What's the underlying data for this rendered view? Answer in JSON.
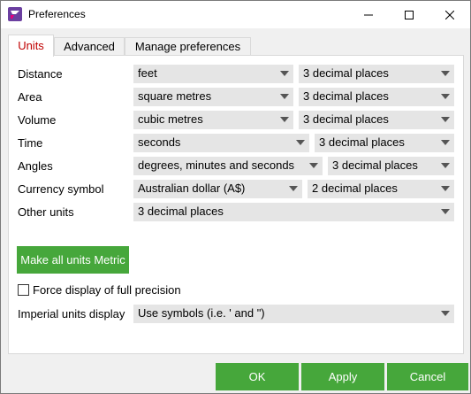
{
  "window": {
    "title": "Preferences"
  },
  "tabs": [
    {
      "label": "Units",
      "active": true
    },
    {
      "label": "Advanced",
      "active": false
    },
    {
      "label": "Manage preferences",
      "active": false
    }
  ],
  "units": {
    "rows": [
      {
        "label": "Distance",
        "unit": "feet",
        "precision": "3 decimal places"
      },
      {
        "label": "Area",
        "unit": "square metres",
        "precision": "3 decimal places"
      },
      {
        "label": "Volume",
        "unit": "cubic metres",
        "precision": "3 decimal places"
      },
      {
        "label": "Time",
        "unit": "seconds",
        "precision": "3 decimal places"
      },
      {
        "label": "Angles",
        "unit": "degrees, minutes and seconds",
        "precision": "3 decimal places"
      },
      {
        "label": "Currency symbol",
        "unit": "Australian dollar (A$)",
        "precision": "2 decimal places"
      }
    ],
    "other_units": {
      "label": "Other units",
      "value": "3 decimal places"
    },
    "metric_button": "Make all units Metric",
    "force_precision": {
      "label": "Force display of full precision",
      "checked": false
    },
    "imperial": {
      "label": "Imperial units display",
      "value": "Use symbols (i.e. ' and \")"
    }
  },
  "footer": {
    "ok": "OK",
    "apply": "Apply",
    "cancel": "Cancel"
  },
  "colors": {
    "accent_green": "#46a73b",
    "active_tab_text": "#c00000",
    "combo_bg": "#e5e5e5"
  },
  "icons": {
    "app": "app-logo-icon",
    "minimize": "minimize-icon",
    "maximize": "maximize-icon",
    "close": "close-icon",
    "dropdown": "chevron-down-icon"
  }
}
